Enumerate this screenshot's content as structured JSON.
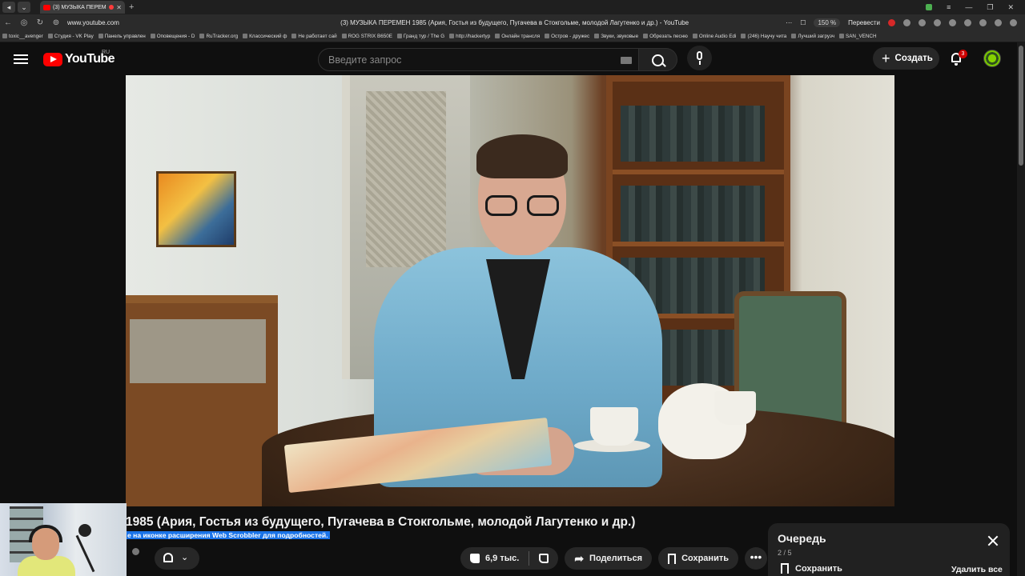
{
  "browser": {
    "tab_title": "(3) МУЗЫКА ПЕРЕМ",
    "url": "www.youtube.com",
    "page_title": "(3) МУЗЫКА ПЕРЕМЕН 1985 (Ария, Гостья из будущего, Пугачева в Стокгольме, молодой Лагутенко и др.) - YouTube",
    "zoom": "150 %",
    "translate_label": "Перевести",
    "bookmarks": [
      "toxic__avenger",
      "Студия - VK Play",
      "Панель управлен",
      "Оповещения - D",
      "RuTracker.org",
      "Классический ф",
      "Не работает сай",
      "ROG STRIX B650E",
      "Гранд тур / The G",
      "http://hackertyp",
      "Онлайн трансля",
      "Остров - дружес",
      "Звуки, звуковые",
      "Обрезать песню",
      "Online Audio Edi",
      "(246) Научу чита",
      "Лучший загрузч",
      "SAN_VENCH"
    ]
  },
  "header": {
    "logo_text": "YouTube",
    "country_code": "RU",
    "search_placeholder": "Введите запрос",
    "create_label": "Создать",
    "notification_count": "3"
  },
  "video": {
    "title": "1985 (Ария, Гостья из будущего, Пугачева в Стокгольме, молодой Лагутенко и др.)",
    "scrobbler_note": "е на иконке расширения Web Scrobbler для подробностей.",
    "likes": "6,9 тыс.",
    "share_label": "Поделиться",
    "save_label": "Сохранить",
    "more_label": "•••"
  },
  "queue": {
    "title": "Очередь",
    "count": "2 / 5",
    "save_label": "Сохранить",
    "delete_label": "Удалить все"
  },
  "colors": {
    "youtube_red": "#ff0000",
    "background": "#0f0f0f",
    "pill": "#272727",
    "highlight": "#1a73e8"
  }
}
